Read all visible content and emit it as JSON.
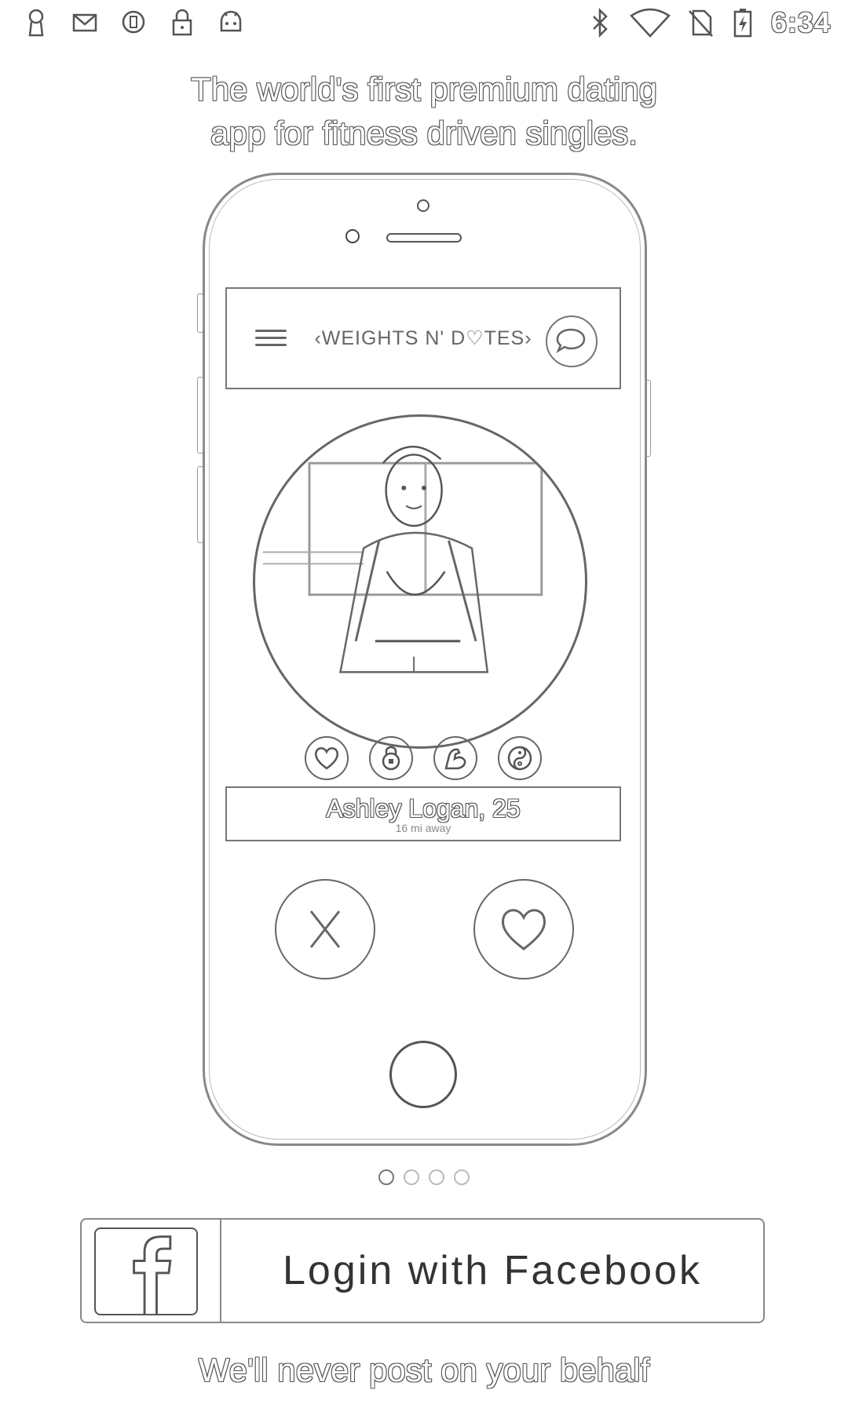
{
  "status_bar": {
    "left_icons": [
      "keyhole-icon",
      "email-icon",
      "circle-status-icon",
      "lock-icon",
      "android-icon"
    ],
    "right_icons": [
      "bluetooth-icon",
      "wifi-icon",
      "no-sim-icon",
      "battery-charging-icon"
    ],
    "time": "6:34"
  },
  "headline": {
    "line1": "The world's first premium dating",
    "line2": "app for fitness driven singles."
  },
  "mockup": {
    "brand": "‹WEIGHTS N' D♡TES›",
    "menu_icon": "hamburger-icon",
    "chat_icon": "chat-bubble-icon",
    "profile_name": "Ashley Logan, 25",
    "profile_distance": "16 mi away",
    "interests": [
      "heart-icon",
      "kettlebell-icon",
      "flexed-arm-icon",
      "yin-yang-icon"
    ],
    "dislike_icon": "x-icon",
    "like_icon": "heart-icon"
  },
  "pager": {
    "count": 4,
    "active": 0
  },
  "login": {
    "facebook_label": "Login with Facebook",
    "facebook_icon": "facebook-icon"
  },
  "footer": {
    "note": "We'll never post on your behalf"
  }
}
